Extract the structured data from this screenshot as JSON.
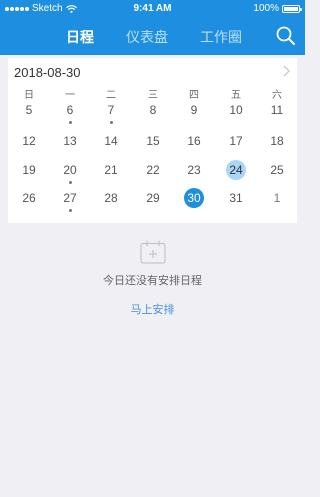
{
  "status_bar": {
    "carrier": "Sketch",
    "time": "9:41 AM",
    "battery": "100%"
  },
  "header": {
    "tabs": [
      "日程",
      "仪表盘",
      "工作圈"
    ],
    "active_tab": 0,
    "icons": {
      "search": "search-icon"
    }
  },
  "calendar": {
    "date": "2018-08-30",
    "weekdays": [
      "日",
      "一",
      "二",
      "三",
      "四",
      "五",
      "六"
    ],
    "weeks": [
      [
        "5",
        "6",
        "7",
        "8",
        "9",
        "10",
        "11"
      ],
      [
        "12",
        "13",
        "14",
        "15",
        "16",
        "17",
        "18"
      ],
      [
        "19",
        "20",
        "21",
        "22",
        "23",
        "24",
        "25"
      ],
      [
        "26",
        "27",
        "28",
        "29",
        "30",
        "31",
        "1"
      ]
    ],
    "selected": "30",
    "highlighted": "24",
    "event_days": [
      "6",
      "7",
      "20",
      "27"
    ],
    "next_icon": "chevron-right-icon"
  },
  "empty_state": {
    "icon": "calendar-add-icon",
    "text": "今日还没有安排日程",
    "action": "马上安排"
  },
  "colors": {
    "primary": "#1e8fe0",
    "highlight": "#a9d6f7",
    "background": "#efeff4",
    "link": "#4a90d9"
  }
}
